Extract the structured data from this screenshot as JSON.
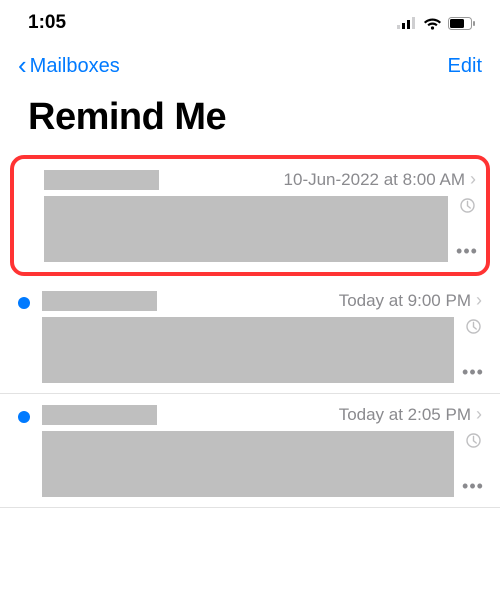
{
  "status_bar": {
    "time": "1:05"
  },
  "nav": {
    "back_label": "Mailboxes",
    "edit_label": "Edit"
  },
  "page_title": "Remind Me",
  "messages": [
    {
      "date": "10-Jun-2022 at 8:00 AM",
      "unread": false,
      "highlighted": true
    },
    {
      "date": "Today at 9:00 PM",
      "unread": true,
      "highlighted": false
    },
    {
      "date": "Today at 2:05 PM",
      "unread": true,
      "highlighted": false
    }
  ]
}
